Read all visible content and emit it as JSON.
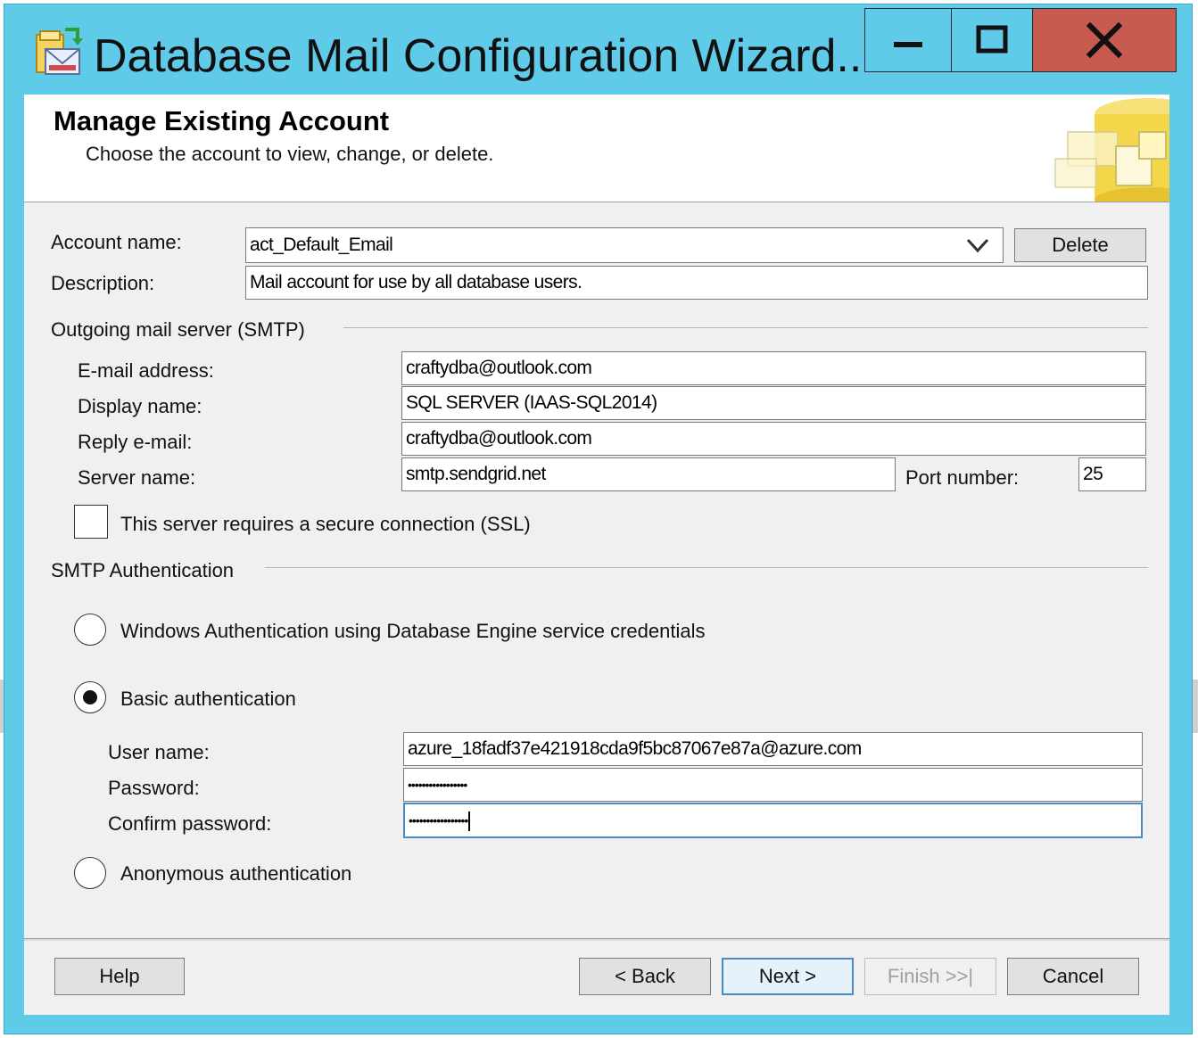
{
  "window": {
    "title": "Database Mail Configuration Wizard..."
  },
  "header": {
    "title": "Manage Existing Account",
    "subtitle": "Choose the account to view, change, or delete."
  },
  "account": {
    "name_label": "Account name:",
    "name_value": "act_Default_Email",
    "delete_label": "Delete",
    "description_label": "Description:",
    "description_value": "Mail account for use by all database users."
  },
  "smtp": {
    "section_label": "Outgoing mail server (SMTP)",
    "email_label": "E-mail address:",
    "email_value": "craftydba@outlook.com",
    "display_label": "Display name:",
    "display_value": "SQL SERVER (IAAS-SQL2014)",
    "reply_label": "Reply e-mail:",
    "reply_value": "craftydba@outlook.com",
    "server_label": "Server name:",
    "server_value": "smtp.sendgrid.net",
    "port_label": "Port number:",
    "port_value": "25",
    "ssl_label": "This server requires a secure connection (SSL)",
    "ssl_checked": false
  },
  "auth": {
    "section_label": "SMTP Authentication",
    "windows_label": "Windows Authentication using Database Engine service credentials",
    "basic_label": "Basic authentication",
    "anonymous_label": "Anonymous authentication",
    "selected": "basic",
    "user_label": "User name:",
    "user_value": "azure_18fadf37e421918cda9f5bc87067e87a@azure.com",
    "password_label": "Password:",
    "password_value": "•••••••••••••••••",
    "confirm_label": "Confirm password:",
    "confirm_value": "•••••••••••••••••"
  },
  "footer": {
    "help": "Help",
    "back": "< Back",
    "next": "Next >",
    "finish": "Finish >>|",
    "cancel": "Cancel"
  },
  "colors": {
    "titlebar": "#60cbe9",
    "close": "#c75b50",
    "dialog_bg": "#f0f0f0",
    "focus_border": "#4d88c6"
  },
  "icons": {
    "title": "mail-wizard-icon",
    "header": "database-mail-icon",
    "minimize": "minimize-icon",
    "maximize": "maximize-icon",
    "close": "close-icon",
    "dropdown": "chevron-down-icon"
  }
}
